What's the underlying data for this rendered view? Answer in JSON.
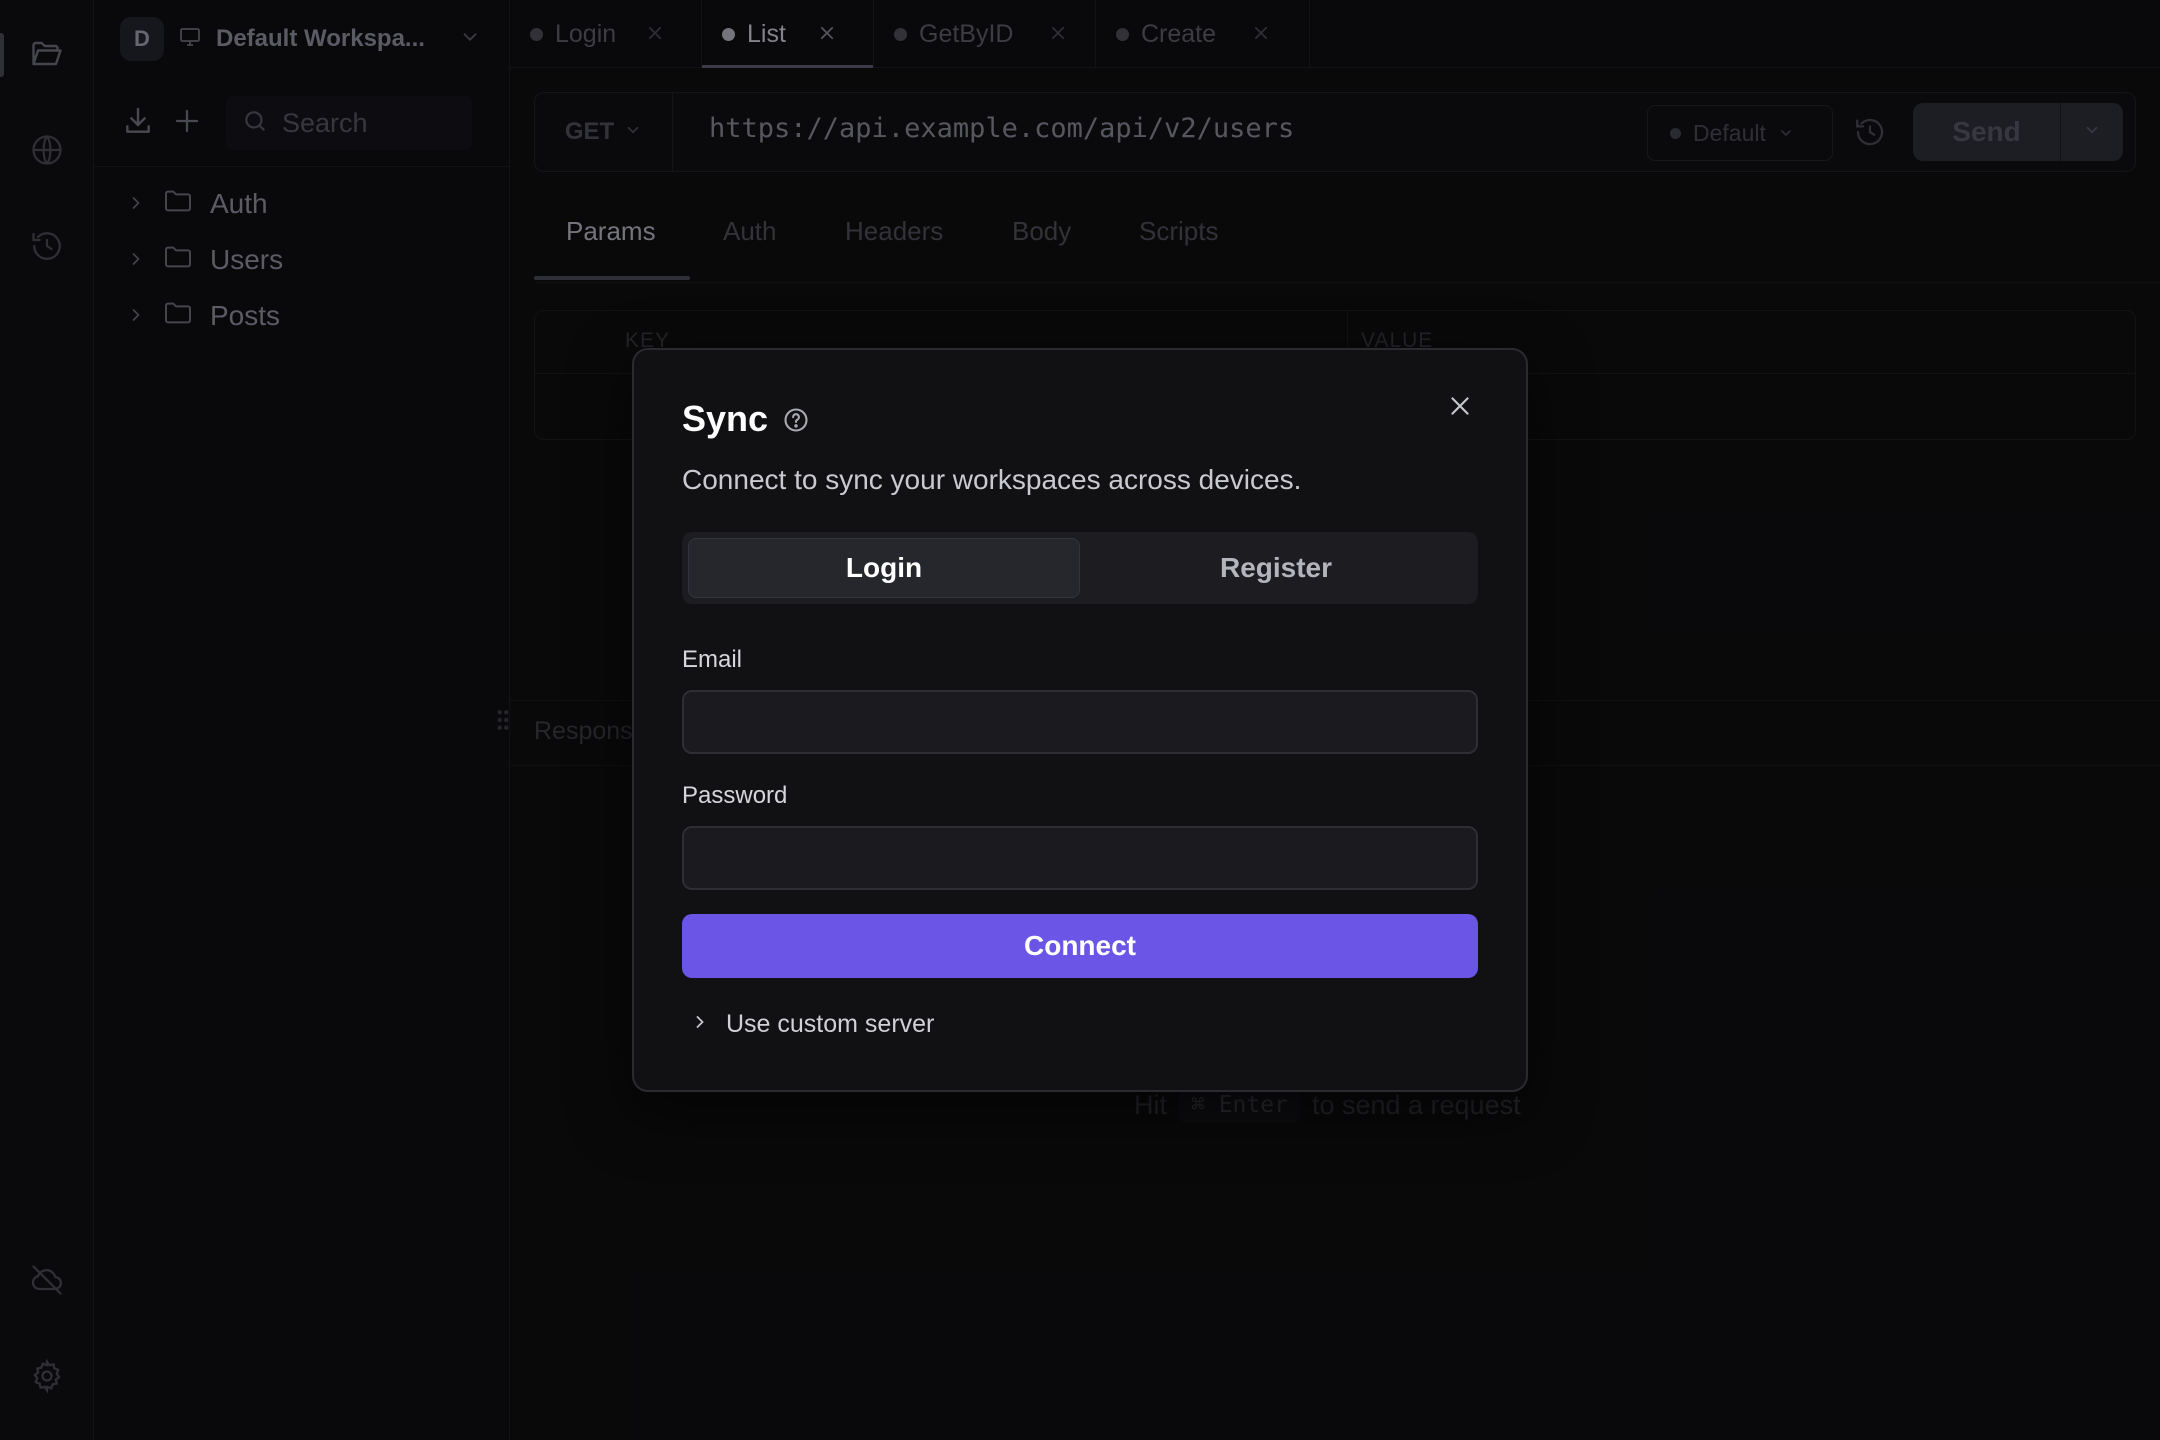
{
  "workspace": {
    "badge": "D",
    "name": "Default Workspa..."
  },
  "sidebar": {
    "search_placeholder": "Search",
    "items": [
      {
        "label": "Auth"
      },
      {
        "label": "Users"
      },
      {
        "label": "Posts"
      }
    ]
  },
  "tabs": [
    {
      "label": "Login",
      "active": false
    },
    {
      "label": "List",
      "active": true
    },
    {
      "label": "GetByID",
      "active": false
    },
    {
      "label": "Create",
      "active": false
    }
  ],
  "request": {
    "method": "GET",
    "url": "https://api.example.com/api/v2/users",
    "environment": "Default",
    "send_label": "Send"
  },
  "request_tabs": [
    {
      "label": "Params"
    },
    {
      "label": "Auth"
    },
    {
      "label": "Headers"
    },
    {
      "label": "Body"
    },
    {
      "label": "Scripts"
    }
  ],
  "params_table": {
    "key_header": "KEY",
    "value_header": "VALUE"
  },
  "response": {
    "label": "Respons",
    "hint_prefix": "Hit",
    "hint_key": "⌘ Enter",
    "hint_suffix": "to send a request"
  },
  "modal": {
    "title": "Sync",
    "subtitle": "Connect to sync your workspaces across devices.",
    "segments": {
      "login": "Login",
      "register": "Register"
    },
    "email_label": "Email",
    "email_value": "",
    "password_label": "Password",
    "password_value": "",
    "connect_label": "Connect",
    "custom_server_label": "Use custom server"
  },
  "colors": {
    "accent": "#6b55e6",
    "modal_bg": "#111114"
  }
}
